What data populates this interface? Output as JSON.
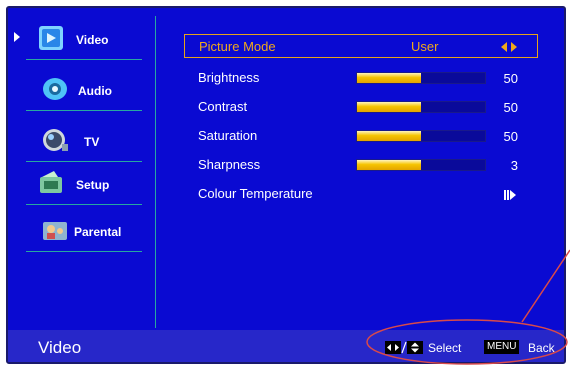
{
  "sidebar": {
    "items": [
      {
        "label": "Video",
        "icon": "video-icon",
        "selected": true
      },
      {
        "label": "Audio",
        "icon": "audio-icon"
      },
      {
        "label": "TV",
        "icon": "tv-icon"
      },
      {
        "label": "Setup",
        "icon": "setup-icon"
      },
      {
        "label": "Parental",
        "icon": "parental-icon"
      }
    ]
  },
  "menu": {
    "picture_mode": {
      "label": "Picture Mode",
      "value": "User"
    },
    "brightness": {
      "label": "Brightness",
      "value": "50",
      "level": 0.5
    },
    "contrast": {
      "label": "Contrast",
      "value": "50",
      "level": 0.5
    },
    "saturation": {
      "label": "Saturation",
      "value": "50",
      "level": 0.5
    },
    "sharpness": {
      "label": "Sharpness",
      "value": "3",
      "level": 0.5
    },
    "colour_temperature": {
      "label": "Colour Temperature"
    }
  },
  "footer": {
    "title": "Video",
    "select_label": "Select",
    "menu_key": "MENU",
    "back_label": "Back"
  },
  "colors": {
    "background": "#0a0ad2",
    "highlight": "#f0a81c",
    "divider": "#27a7a0",
    "annotation": "#d94a4a"
  }
}
